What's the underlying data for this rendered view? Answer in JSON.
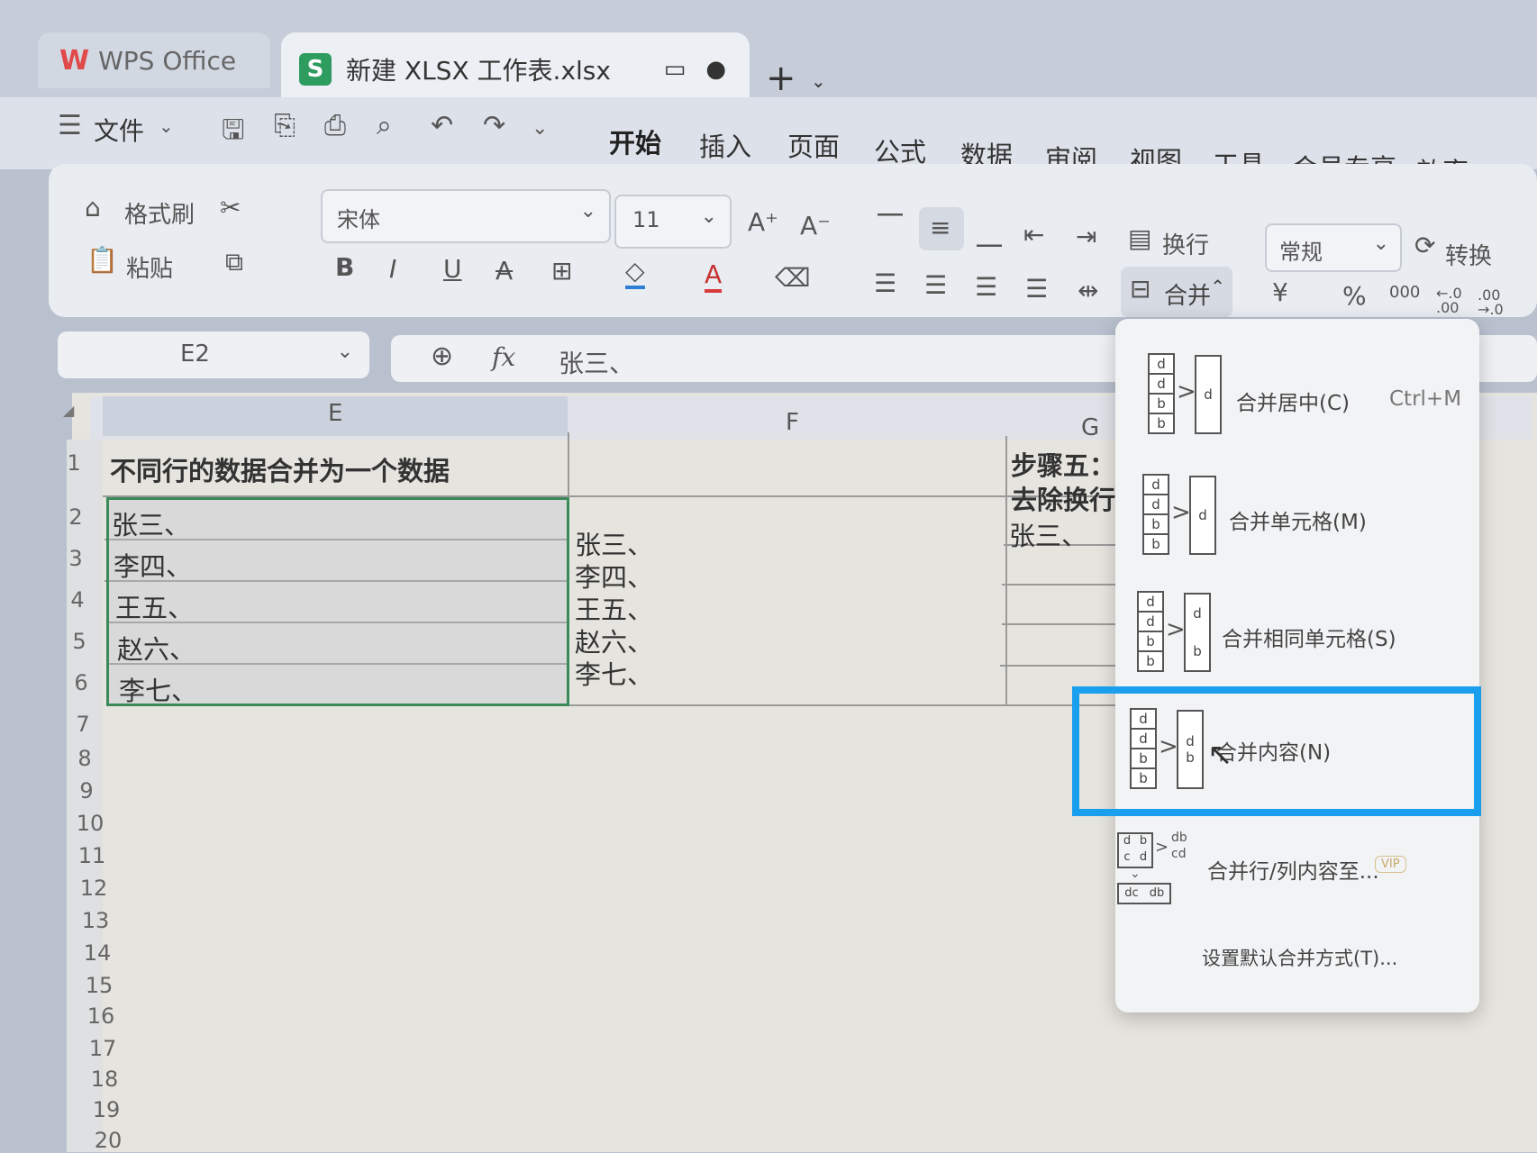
{
  "window": {
    "app_tab": "WPS Office",
    "file_tab": "新建 XLSX 工作表.xlsx",
    "file_icon_letter": "S"
  },
  "menu": {
    "file_label": "文件",
    "tabs": [
      "开始",
      "插入",
      "页面",
      "公式",
      "数据",
      "审阅",
      "视图",
      "工具",
      "会员专享",
      "效率"
    ]
  },
  "ribbon": {
    "format_painter": "格式刷",
    "paste": "粘贴",
    "font_name": "宋体",
    "font_size": "11",
    "wrap_text": "换行",
    "merge": "合并",
    "number_format": "常规",
    "convert": "转换",
    "font_increase": "A⁺",
    "font_decrease": "A⁻",
    "bold": "B",
    "italic": "I",
    "underline": "U",
    "strike": "A",
    "currency": "¥",
    "percent": "%",
    "thousands": "000",
    "dec_inc": "←.0\n.00",
    "dec_dec": ".00\n→.0"
  },
  "formula_bar": {
    "name_box": "E2",
    "fx": "fx",
    "content": "张三、"
  },
  "sheet": {
    "columns": [
      "E",
      "F",
      "G"
    ],
    "rows": [
      "1",
      "2",
      "3",
      "4",
      "5",
      "6",
      "7",
      "8",
      "9",
      "10",
      "11",
      "12",
      "13",
      "14",
      "15",
      "16",
      "17",
      "18",
      "19",
      "20"
    ],
    "e1": "不同行的数据合并为一个数据",
    "e_values": [
      "张三、",
      "李四、",
      "王五、",
      "赵六、",
      "李七、"
    ],
    "f_values": [
      "张三、",
      "李四、",
      "王五、",
      "赵六、",
      "李七、"
    ],
    "g1_line1": "步骤五：",
    "g1_line2": "去除换行",
    "g2": "张三、"
  },
  "merge_menu": {
    "items": [
      {
        "label": "合并居中(C)",
        "shortcut": "Ctrl+M"
      },
      {
        "label": "合并单元格(M)"
      },
      {
        "label": "合并相同单元格(S)"
      },
      {
        "label": "合并内容(N)"
      },
      {
        "label": "合并行/列内容至...",
        "badge": "VIP"
      },
      {
        "label": "设置默认合并方式(T)..."
      }
    ],
    "icon_letters": {
      "a": "d",
      "b": "b"
    },
    "grid_icon": {
      "top": [
        "d",
        "b",
        "c",
        "d"
      ],
      "bottom": [
        "dc",
        "db"
      ],
      "side": [
        "db",
        "cd"
      ]
    }
  },
  "colors": {
    "highlight": "#1a9fef",
    "selection": "#3a8a5a",
    "wps_logo": "#e04a4a",
    "sheet_icon": "#2e9b5f"
  }
}
